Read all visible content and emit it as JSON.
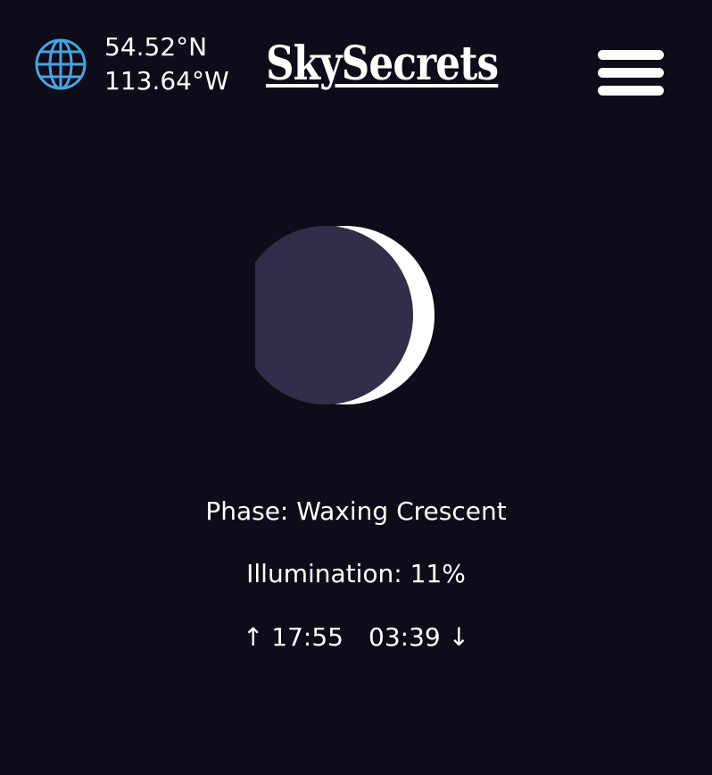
{
  "location": {
    "latitude": "54.52°N",
    "longitude": "113.64°W",
    "icon": "globe-icon"
  },
  "app": {
    "title": "SkySecrets"
  },
  "menu": {
    "icon": "hamburger-menu-icon"
  },
  "moon": {
    "illumination_fraction": 0.11,
    "waxing": true,
    "dark_color": "#302e48",
    "lit_color": "#ffffff"
  },
  "info": {
    "phase": "Phase: Waxing Crescent",
    "illumination": "Illumination: 11%",
    "moonrise": "↑ 17:55",
    "moonset": "03:39 ↓"
  },
  "colors": {
    "background": "#0d0c18",
    "accent": "#4aa3e0",
    "text": "#ffffff"
  }
}
